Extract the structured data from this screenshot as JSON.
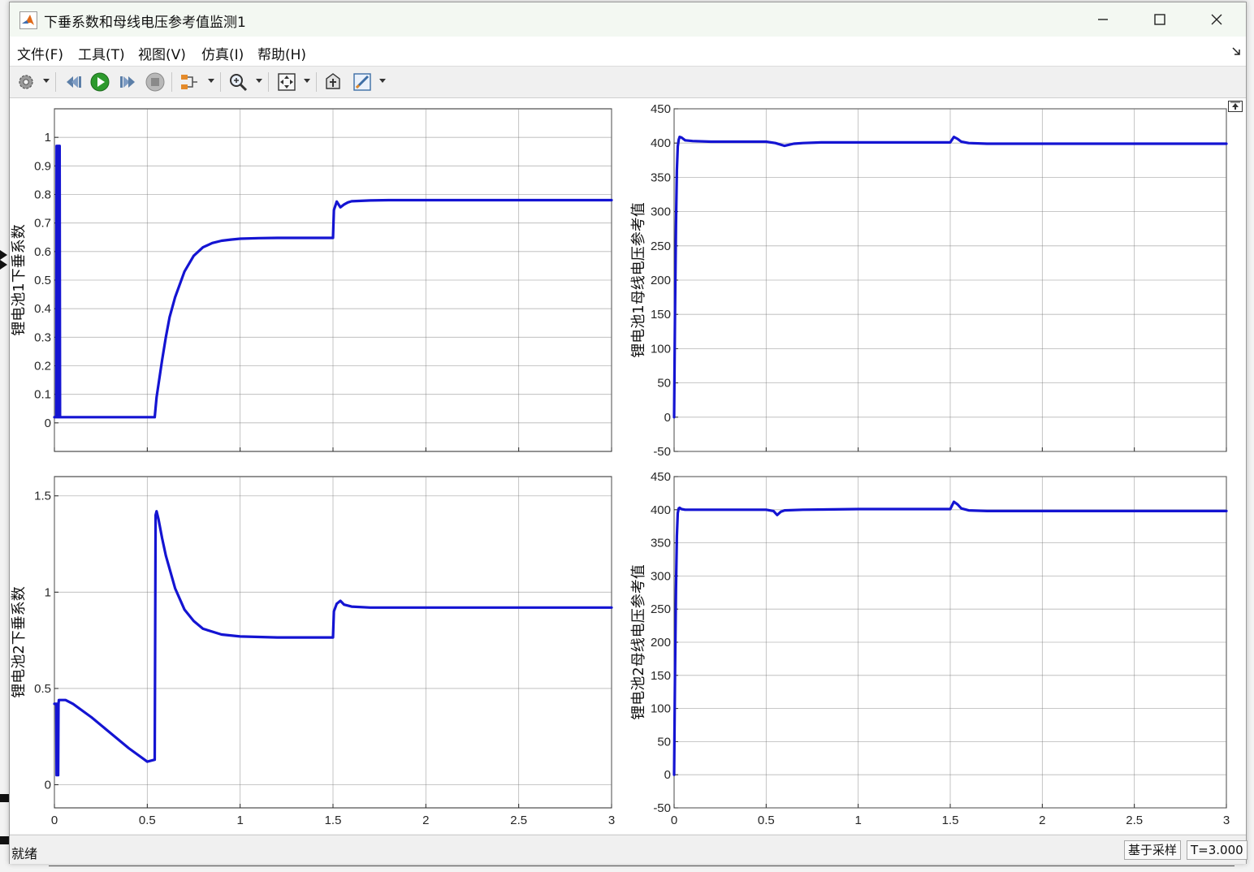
{
  "window": {
    "title": "下垂系数和母线电压参考值监测1"
  },
  "menu": [
    "文件(F)",
    "工具(T)",
    "视图(V)",
    "仿真(I)",
    "帮助(H)"
  ],
  "toolbar": {
    "icons": [
      "gear-icon",
      "step-back-icon",
      "run-icon",
      "step-forward-icon",
      "stop-icon",
      "signal-select-icon",
      "zoom-icon",
      "fit-to-view-icon",
      "write-icon",
      "style-icon"
    ]
  },
  "status": {
    "left": "就绪",
    "sample": "基于采样",
    "time": "T=3.000"
  },
  "colors": {
    "trace": "#1414d2",
    "grid": "#7a7a7a",
    "titlebar": "#f3f8f2"
  },
  "chart_data": [
    {
      "type": "line",
      "ylabel": "锂电池1下垂系数",
      "xlim": [
        0,
        3
      ],
      "ylim": [
        -0.1,
        1.1
      ],
      "yticks": [
        0,
        0.1,
        0.2,
        0.3,
        0.4,
        0.5,
        0.6,
        0.7,
        0.8,
        0.9,
        1
      ],
      "xticks": [
        0,
        0.5,
        1,
        1.5,
        2,
        2.5,
        3
      ],
      "show_xtick_labels": false,
      "grid": true,
      "series": [
        {
          "x": [
            0,
            0.01,
            0.012,
            0.014,
            0.016,
            0.018,
            0.02,
            0.022,
            0.024,
            0.026,
            0.028,
            0.03,
            0.032,
            0.5,
            0.54,
            0.55,
            0.58,
            0.6,
            0.62,
            0.65,
            0.7,
            0.75,
            0.8,
            0.85,
            0.9,
            0.95,
            1.0,
            1.1,
            1.2,
            1.35,
            1.5,
            1.505,
            1.52,
            1.54,
            1.56,
            1.58,
            1.6,
            1.7,
            1.8,
            2.0,
            2.5,
            3.0
          ],
          "y": [
            0.02,
            0.02,
            0.97,
            0.02,
            0.97,
            0.02,
            0.97,
            0.02,
            0.97,
            0.02,
            0.97,
            0.02,
            0.02,
            0.02,
            0.02,
            0.09,
            0.22,
            0.3,
            0.37,
            0.44,
            0.53,
            0.585,
            0.615,
            0.63,
            0.638,
            0.642,
            0.645,
            0.647,
            0.648,
            0.648,
            0.648,
            0.745,
            0.775,
            0.755,
            0.765,
            0.772,
            0.776,
            0.779,
            0.78,
            0.78,
            0.78,
            0.78
          ]
        }
      ]
    },
    {
      "type": "line",
      "ylabel": "锂电池1母线电压参考值",
      "xlim": [
        0,
        3
      ],
      "ylim": [
        -50,
        450
      ],
      "yticks": [
        -50,
        0,
        50,
        100,
        150,
        200,
        250,
        300,
        350,
        400,
        450
      ],
      "xticks": [
        0,
        0.5,
        1,
        1.5,
        2,
        2.5,
        3
      ],
      "show_xtick_labels": false,
      "grid": true,
      "series": [
        {
          "x": [
            0,
            0.005,
            0.01,
            0.015,
            0.02,
            0.025,
            0.03,
            0.04,
            0.06,
            0.1,
            0.2,
            0.5,
            0.55,
            0.6,
            0.65,
            0.7,
            0.8,
            1.0,
            1.2,
            1.5,
            1.52,
            1.54,
            1.56,
            1.6,
            1.7,
            2.0,
            2.5,
            3.0
          ],
          "y": [
            0,
            150,
            280,
            360,
            395,
            405,
            409,
            408,
            404,
            403,
            402,
            402,
            400,
            396,
            399,
            400,
            401,
            401,
            401,
            401,
            409,
            406,
            402,
            400,
            399,
            399,
            399,
            399
          ]
        }
      ]
    },
    {
      "type": "line",
      "ylabel": "锂电池2下垂系数",
      "xlim": [
        0,
        3
      ],
      "ylim": [
        -0.12,
        1.6
      ],
      "yticks": [
        0,
        0.5,
        1,
        1.5
      ],
      "xticks": [
        0,
        0.5,
        1,
        1.5,
        2,
        2.5,
        3
      ],
      "show_xtick_labels": true,
      "grid": true,
      "series": [
        {
          "x": [
            0,
            0.01,
            0.012,
            0.014,
            0.016,
            0.018,
            0.02,
            0.022,
            0.024,
            0.04,
            0.06,
            0.1,
            0.2,
            0.3,
            0.4,
            0.5,
            0.54,
            0.545,
            0.55,
            0.56,
            0.58,
            0.6,
            0.65,
            0.7,
            0.75,
            0.8,
            0.9,
            1.0,
            1.2,
            1.5,
            1.505,
            1.52,
            1.54,
            1.56,
            1.6,
            1.7,
            2.0,
            2.5,
            3.0
          ],
          "y": [
            0.42,
            0.42,
            0.05,
            0.42,
            0.05,
            0.42,
            0.05,
            0.42,
            0.44,
            0.44,
            0.44,
            0.42,
            0.35,
            0.27,
            0.19,
            0.12,
            0.13,
            1.4,
            1.42,
            1.38,
            1.28,
            1.19,
            1.02,
            0.91,
            0.85,
            0.81,
            0.78,
            0.77,
            0.765,
            0.765,
            0.9,
            0.94,
            0.955,
            0.935,
            0.925,
            0.92,
            0.92,
            0.92,
            0.92
          ]
        }
      ]
    },
    {
      "type": "line",
      "ylabel": "锂电池2母线电压参考值",
      "xlim": [
        0,
        3
      ],
      "ylim": [
        -50,
        450
      ],
      "yticks": [
        -50,
        0,
        50,
        100,
        150,
        200,
        250,
        300,
        350,
        400,
        450
      ],
      "xticks": [
        0,
        0.5,
        1,
        1.5,
        2,
        2.5,
        3
      ],
      "show_xtick_labels": true,
      "grid": true,
      "series": [
        {
          "x": [
            0,
            0.005,
            0.01,
            0.015,
            0.02,
            0.025,
            0.03,
            0.04,
            0.06,
            0.1,
            0.5,
            0.54,
            0.56,
            0.58,
            0.6,
            0.7,
            1.0,
            1.5,
            1.52,
            1.54,
            1.56,
            1.6,
            1.7,
            2.0,
            2.5,
            3.0
          ],
          "y": [
            0,
            150,
            280,
            360,
            395,
            402,
            403,
            401,
            400,
            400,
            400,
            398,
            392,
            397,
            399,
            400,
            401,
            401,
            412,
            408,
            402,
            399,
            398,
            398,
            398,
            398
          ]
        }
      ]
    }
  ]
}
